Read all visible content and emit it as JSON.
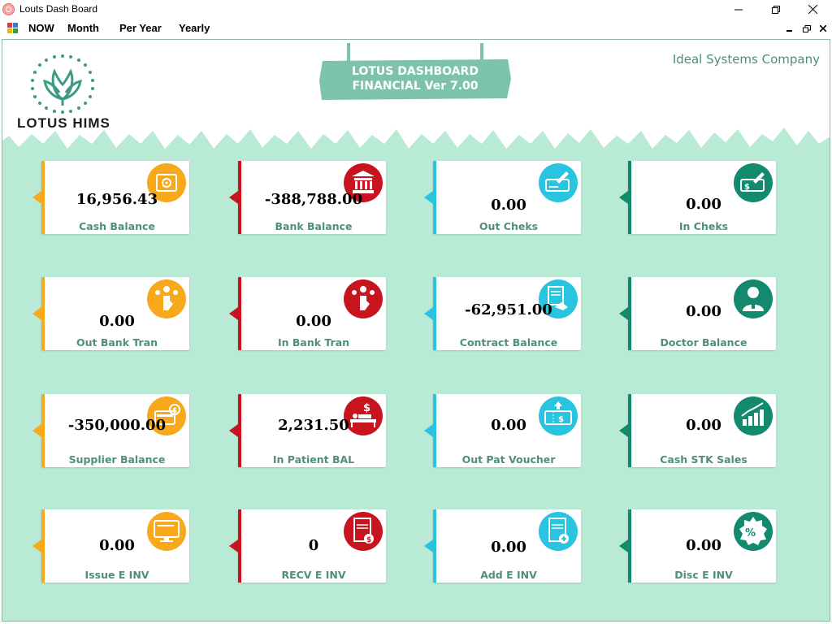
{
  "window": {
    "title": "Louts Dash Board"
  },
  "menu": {
    "items": [
      {
        "label": "NOW"
      },
      {
        "label": "Month"
      },
      {
        "label": "Per Year"
      },
      {
        "label": "Yearly"
      }
    ]
  },
  "header": {
    "logo_text": "LOTUS HIMS",
    "sign_line1": "LOTUS DASHBOARD",
    "sign_line2": "FINANCIAL Ver 7.00",
    "company": "Ideal Systems Company"
  },
  "colors": {
    "orange": "#f7a81b",
    "red": "#c8141e",
    "cyan": "#29c4e0",
    "green": "#138a6e",
    "label_green": "#4e8f7a",
    "background": "#b8ead5"
  },
  "cards": [
    {
      "value": "16,956.43",
      "label": "Cash Balance",
      "icon": "safe-icon",
      "color": "orange"
    },
    {
      "value": "-388,788.00",
      "label": "Bank Balance",
      "icon": "bank-icon",
      "color": "red"
    },
    {
      "value": "0.00",
      "label": "Out Cheks",
      "icon": "cheque-out-icon",
      "color": "cyan"
    },
    {
      "value": "0.00",
      "label": "In Cheks",
      "icon": "cheque-in-icon",
      "color": "green"
    },
    {
      "value": "0.00",
      "label": "Out Bank Tran",
      "icon": "transfer-out-icon",
      "color": "orange"
    },
    {
      "value": "0.00",
      "label": "In Bank Tran",
      "icon": "transfer-in-icon",
      "color": "red"
    },
    {
      "value": "-62,951.00",
      "label": "Contract Balance",
      "icon": "contract-icon",
      "color": "cyan"
    },
    {
      "value": "0.00",
      "label": "Doctor Balance",
      "icon": "doctor-icon",
      "color": "green"
    },
    {
      "value": "-350,000.00",
      "label": "Supplier Balance",
      "icon": "supplier-icon",
      "color": "orange"
    },
    {
      "value": "2,231.50",
      "label": "In Patient BAL",
      "icon": "patient-bed-icon",
      "color": "red"
    },
    {
      "value": "0.00",
      "label": "Out Pat Voucher",
      "icon": "voucher-icon",
      "color": "cyan"
    },
    {
      "value": "0.00",
      "label": "Cash STK Sales",
      "icon": "stock-sales-icon",
      "color": "green"
    },
    {
      "value": "0.00",
      "label": "Issue E INV",
      "icon": "invoice-monitor-icon",
      "color": "orange"
    },
    {
      "value": "0",
      "label": "RECV E INV",
      "icon": "invoice-receive-icon",
      "color": "red"
    },
    {
      "value": "0.00",
      "label": "Add E INV",
      "icon": "invoice-add-icon",
      "color": "cyan"
    },
    {
      "value": "0.00",
      "label": "Disc E INV",
      "icon": "discount-icon",
      "color": "green"
    }
  ]
}
